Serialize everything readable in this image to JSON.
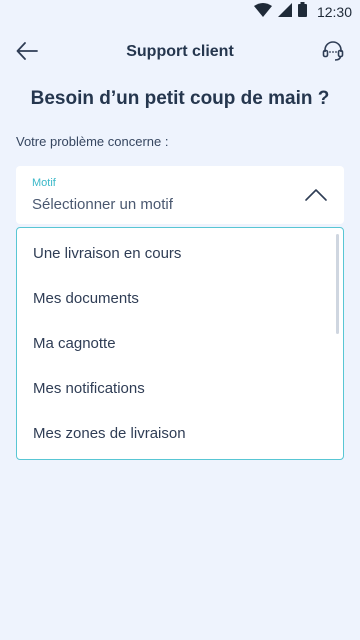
{
  "status_bar": {
    "time": "12:30"
  },
  "app_bar": {
    "title": "Support client"
  },
  "heading": "Besoin d’un petit coup de main ?",
  "question": "Votre problème concerne :",
  "select": {
    "label": "Motif",
    "placeholder": "Sélectionner un motif",
    "expanded": true
  },
  "options": [
    "Une livraison en cours",
    "Mes documents",
    "Ma cagnotte",
    "Mes notifications",
    "Mes zones de livraison"
  ],
  "colors": {
    "accent": "#3ab8c8",
    "background": "#eef3fd",
    "text_dark": "#25364e"
  },
  "icons": {
    "back": "arrow-left-icon",
    "support": "headset-icon",
    "chevron": "chevron-up-icon"
  }
}
